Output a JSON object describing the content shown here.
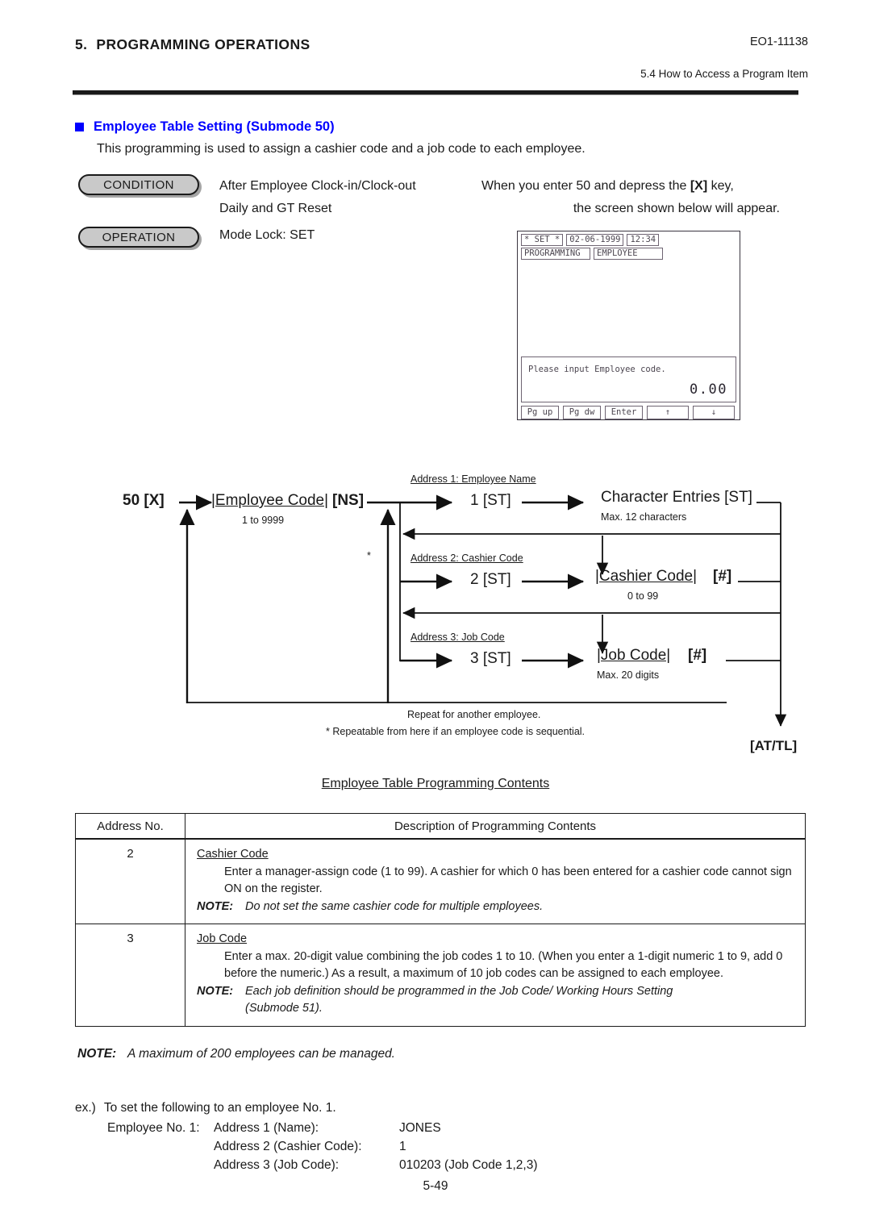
{
  "header": {
    "chapter_number": "5.",
    "chapter_title": "PROGRAMMING OPERATIONS",
    "doc_code": "EO1-11138",
    "section_ref": "5.4  How to Access a Program Item"
  },
  "section": {
    "title": "Employee Table Setting (Submode 50)",
    "title_color": "#0000FF",
    "description": "This programming is used to assign a cashier code and a job code to each employee."
  },
  "badges": {
    "condition_label": "CONDITION",
    "operation_label": "OPERATION"
  },
  "condition": {
    "line1": "After Employee Clock-in/Clock-out",
    "line2": "Daily and GT Reset",
    "right_line1_a": "When you enter 50 and depress the ",
    "right_line1_key": "[X]",
    "right_line1_b": " key,",
    "right_line2": "the screen shown below will appear."
  },
  "operation": {
    "line1": "Mode Lock:  SET"
  },
  "lcd": {
    "mode": "* SET *",
    "date": "02-06-1999",
    "time": "12:34",
    "field1": "PROGRAMMING",
    "field2": "EMPLOYEE",
    "message": "Please input Employee code.",
    "amount": "0.00",
    "keys": [
      "Pg up",
      "Pg dw",
      "Enter",
      "↑",
      "↓"
    ]
  },
  "flow": {
    "start": "50",
    "start_key": "[X]",
    "employee_code": "|Employee Code|",
    "employee_code_key": "[NS]",
    "employee_code_range": "1 to 9999",
    "asterisk": "*",
    "rows": [
      {
        "address_label": "Address 1:  Employee Name",
        "step": "1",
        "step_key": "[ST]",
        "entry": "Character Entries",
        "entry_key": "[ST]",
        "entry_range": "Max. 12 characters"
      },
      {
        "address_label": "Address 2:  Cashier Code",
        "step": "2",
        "step_key": "[ST]",
        "entry": "|Cashier Code|",
        "entry_key": "[#]",
        "entry_range": "0 to 99"
      },
      {
        "address_label": "Address 3:  Job Code",
        "step": "3",
        "step_key": "[ST]",
        "entry": "|Job Code|",
        "entry_key": "[#]",
        "entry_range": "Max. 20 digits"
      }
    ],
    "repeat_note": "Repeat for another employee.",
    "repeat_note2": "* Repeatable from here if an employee code is sequential.",
    "finish_key": "[AT/TL]"
  },
  "table": {
    "caption": "Employee Table Programming Contents",
    "columns": [
      "Address No.",
      "Description of Programming Contents"
    ],
    "rows": [
      {
        "address": "2",
        "heading": "Cashier Code",
        "body": "Enter a manager-assign code (1 to 99). A cashier for which 0 has been entered for a cashier code cannot sign ON on the register.",
        "note_label": "NOTE:",
        "note_text": "Do not set the same cashier code for multiple employees.",
        "note_cont": ""
      },
      {
        "address": "3",
        "heading": "Job Code",
        "body": "Enter a max. 20-digit value combining the job codes 1 to 10. (When you enter a 1-digit numeric 1 to 9, add 0 before the numeric.) As a result, a maximum of 10 job codes can be assigned to each employee.",
        "note_label": "NOTE:",
        "note_text": "Each job definition should be programmed in the Job Code/ Working Hours Setting",
        "note_cont": "(Submode 51)."
      }
    ]
  },
  "bottom_note": {
    "label": "NOTE:",
    "text": "A maximum of 200 employees can be managed."
  },
  "example": {
    "prefix": "ex.)",
    "intro": "To set the following to an employee No. 1.",
    "subject": "Employee No. 1:",
    "rows": [
      {
        "address": "Address 1 (Name):",
        "value": "JONES"
      },
      {
        "address": "Address 2 (Cashier Code):",
        "value": "1"
      },
      {
        "address": "Address 3 (Job Code):",
        "value": "010203 (Job Code 1,2,3)"
      }
    ]
  },
  "footer": {
    "page_number": "5-49"
  }
}
